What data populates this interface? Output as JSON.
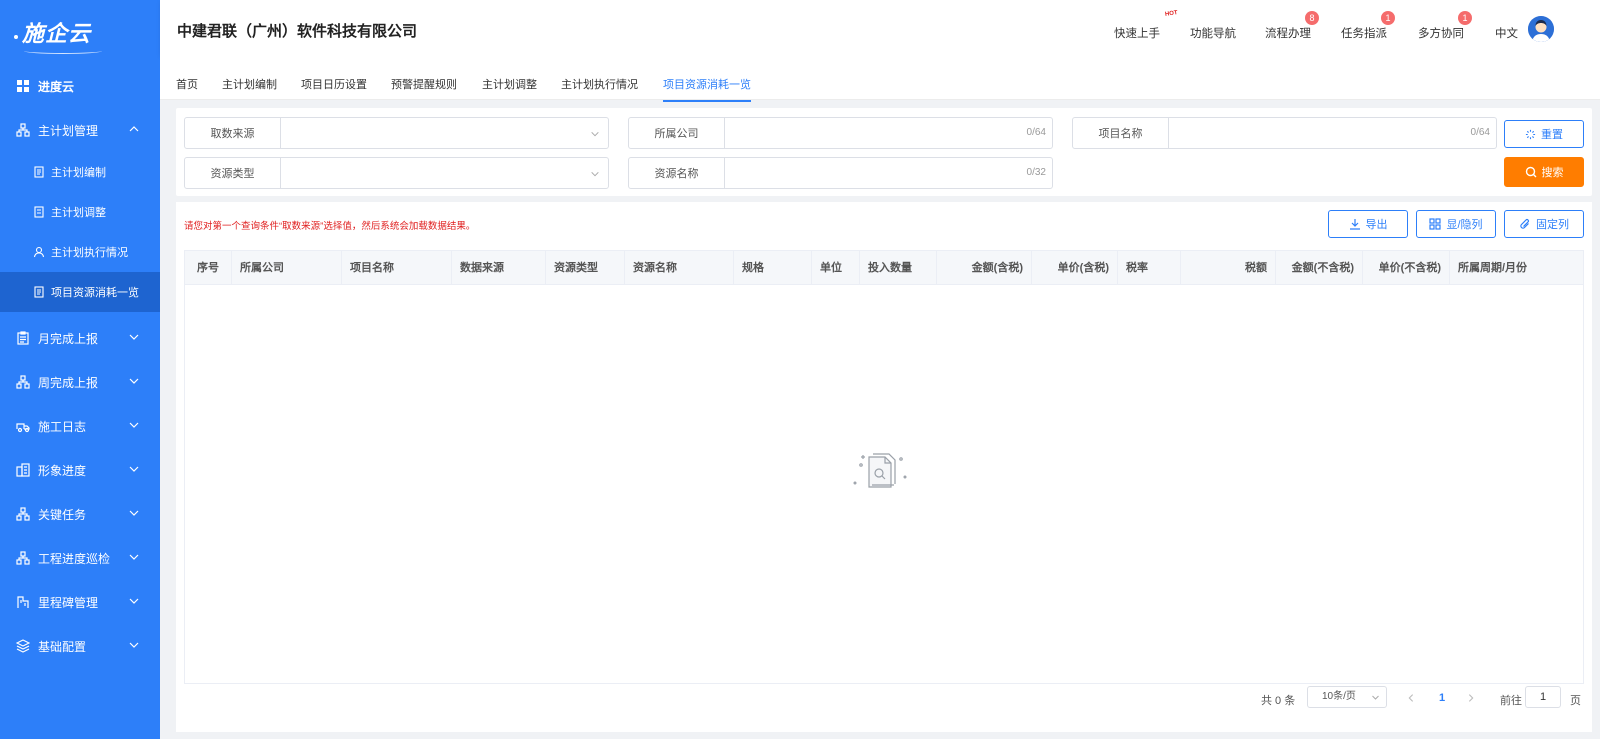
{
  "sidebar": {
    "logo": "施企云",
    "items": [
      {
        "label": "进度云"
      },
      {
        "label": "主计划管理"
      },
      {
        "label": "主计划编制"
      },
      {
        "label": "主计划调整"
      },
      {
        "label": "主计划执行情况"
      },
      {
        "label": "项目资源消耗一览"
      },
      {
        "label": "月完成上报"
      },
      {
        "label": "周完成上报"
      },
      {
        "label": "施工日志"
      },
      {
        "label": "形象进度"
      },
      {
        "label": "关键任务"
      },
      {
        "label": "工程进度巡检"
      },
      {
        "label": "里程碑管理"
      },
      {
        "label": "基础配置"
      }
    ]
  },
  "header": {
    "company": "中建君联（广州）软件科技有限公司",
    "links": [
      {
        "label": "快速上手",
        "badge": "HOT"
      },
      {
        "label": "功能导航",
        "badge": ""
      },
      {
        "label": "流程办理",
        "badge": "8"
      },
      {
        "label": "任务指派",
        "badge": "1"
      },
      {
        "label": "多方协同",
        "badge": "1"
      }
    ],
    "lang": "中文"
  },
  "tabs": [
    "首页",
    "主计划编制",
    "项目日历设置",
    "预警提醒规则",
    "主计划调整",
    "主计划执行情况",
    "项目资源消耗一览"
  ],
  "filters": {
    "source": {
      "label": "取数来源"
    },
    "company": {
      "label": "所属公司",
      "count": "0/64"
    },
    "project": {
      "label": "项目名称",
      "count": "0/64"
    },
    "resType": {
      "label": "资源类型"
    },
    "resName": {
      "label": "资源名称",
      "count": "0/32"
    },
    "reset": "重置",
    "search": "搜索"
  },
  "toolbar": {
    "hint": "请您对第一个查询条件“取数来源”选择值，然后系统会加载数据结果。",
    "export": "导出",
    "toggle": "显/隐列",
    "pin": "固定列"
  },
  "table": {
    "columns": [
      "序号",
      "所属公司",
      "项目名称",
      "数据来源",
      "资源类型",
      "资源名称",
      "规格",
      "单位",
      "投入数量",
      "金额(含税)",
      "单价(含税)",
      "税率",
      "税额",
      "金额(不含税)",
      "单价(不含税)",
      "所属周期/月份"
    ]
  },
  "pager": {
    "total": "共 0 条",
    "size": "10条/页",
    "page": "1",
    "goto": "前往",
    "goto_value": "1",
    "unit": "页"
  },
  "colors": {
    "sidebar": "#2d7ff9",
    "accent": "#2d7ff9",
    "search": "#ff7d00",
    "hint": "#e02020"
  }
}
